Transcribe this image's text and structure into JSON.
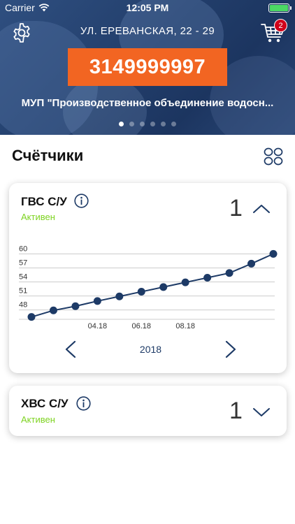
{
  "status_bar": {
    "carrier": "Carrier",
    "time": "12:05 PM"
  },
  "header": {
    "address": "УЛ. ЕРЕВАНСКАЯ, 22 - 29",
    "cart_badge": "2",
    "account_number": "3149999997",
    "organization": "МУП \"Производственное объединение водосн...",
    "carousel_pages": 6,
    "carousel_active": 1
  },
  "section": {
    "title": "Счётчики"
  },
  "meters": [
    {
      "name": "ГВС С/У",
      "status": "Активен",
      "count": "1",
      "expanded": true,
      "year": "2018"
    },
    {
      "name": "ХВС С/У",
      "status": "Активен",
      "count": "1",
      "expanded": false
    }
  ],
  "chart_data": {
    "type": "line",
    "x": [
      "01.18",
      "02.18",
      "03.18",
      "04.18",
      "05.18",
      "06.18",
      "07.18",
      "08.18",
      "09.18",
      "10.18",
      "11.18",
      "12.18"
    ],
    "x_tick_labels": [
      "04.18",
      "06.18",
      "08.18"
    ],
    "values": [
      46.5,
      47.9,
      48.8,
      49.9,
      50.9,
      51.9,
      52.9,
      53.9,
      54.9,
      55.9,
      57.9,
      60.0
    ],
    "y_ticks": [
      48,
      51,
      54,
      57,
      60
    ],
    "ylim": [
      46,
      62
    ],
    "grid": true,
    "colors": {
      "line": "#1d3a66",
      "point": "#1d3a66",
      "grid": "#cccccc"
    }
  },
  "colors": {
    "accent_orange": "#f26522",
    "status_green": "#7ed321",
    "badge_red": "#d0021b",
    "navy": "#1d3a66"
  },
  "icons": {
    "settings": "gear-icon",
    "cart": "cart-icon",
    "grid": "grid-view-icon",
    "info": "info-icon",
    "collapse": "chevron-up-icon",
    "expand": "chevron-down-icon",
    "prev": "chevron-left-icon",
    "next": "chevron-right-icon"
  }
}
